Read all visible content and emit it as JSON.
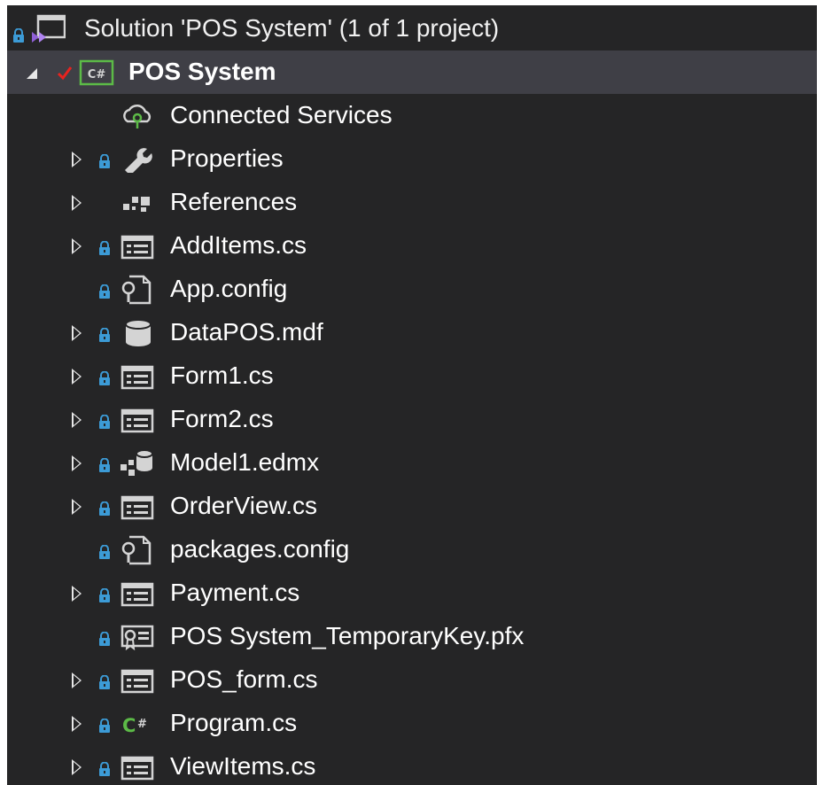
{
  "solution": {
    "label": "Solution 'POS System' (1 of 1 project)",
    "icon": "solution-icon"
  },
  "project": {
    "label": "POS System",
    "icon": "csharp-project-icon",
    "status": "checked-in"
  },
  "items": [
    {
      "label": "Connected Services",
      "icon": "connected-services-icon",
      "expandable": false,
      "locked": false
    },
    {
      "label": "Properties",
      "icon": "wrench-icon",
      "expandable": true,
      "locked": true
    },
    {
      "label": "References",
      "icon": "references-icon",
      "expandable": true,
      "locked": false
    },
    {
      "label": "AddItems.cs",
      "icon": "form-icon",
      "expandable": true,
      "locked": true
    },
    {
      "label": "App.config",
      "icon": "config-file-icon",
      "expandable": false,
      "locked": true
    },
    {
      "label": "DataPOS.mdf",
      "icon": "database-icon",
      "expandable": true,
      "locked": true
    },
    {
      "label": "Form1.cs",
      "icon": "form-icon",
      "expandable": true,
      "locked": true
    },
    {
      "label": "Form2.cs",
      "icon": "form-icon",
      "expandable": true,
      "locked": true
    },
    {
      "label": "Model1.edmx",
      "icon": "entity-model-icon",
      "expandable": true,
      "locked": true
    },
    {
      "label": "OrderView.cs",
      "icon": "form-icon",
      "expandable": true,
      "locked": true
    },
    {
      "label": "packages.config",
      "icon": "config-file-icon",
      "expandable": false,
      "locked": true
    },
    {
      "label": "Payment.cs",
      "icon": "form-icon",
      "expandable": true,
      "locked": true
    },
    {
      "label": "POS System_TemporaryKey.pfx",
      "icon": "certificate-icon",
      "expandable": false,
      "locked": true
    },
    {
      "label": "POS_form.cs",
      "icon": "form-icon",
      "expandable": true,
      "locked": true
    },
    {
      "label": "Program.cs",
      "icon": "csharp-file-icon",
      "expandable": true,
      "locked": true
    },
    {
      "label": "ViewItems.cs",
      "icon": "form-icon",
      "expandable": true,
      "locked": true
    }
  ],
  "colors": {
    "background": "#252526",
    "selected_row": "#3f3f46",
    "text": "#ffffff",
    "lock": "#3c9bd6",
    "check": "#e8231f",
    "csharp_green": "#5cba47",
    "icon_gray": "#d4d4d4"
  }
}
